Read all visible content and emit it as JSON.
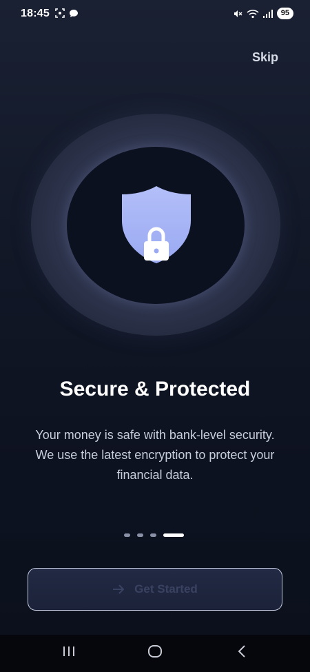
{
  "status_bar": {
    "time": "18:45",
    "battery": "95",
    "left_icons": [
      "screenshot-icon",
      "chat-bubble-icon"
    ],
    "right_icons": [
      "mute-icon",
      "wifi-icon",
      "signal-icon"
    ]
  },
  "header": {
    "skip_label": "Skip"
  },
  "hero": {
    "icon": "shield-lock-icon",
    "colors": {
      "shield": "#a6b4f7",
      "lock": "#ffffff",
      "ring": "#2f364f"
    }
  },
  "content": {
    "title": "Secure & Protected",
    "description": "Your money is safe with bank-level security. We use the latest encryption to protect your financial data."
  },
  "pager": {
    "total": 4,
    "active_index": 3
  },
  "cta": {
    "label": "Get Started",
    "icon": "arrow-right-icon"
  },
  "nav_bar": {
    "buttons": [
      "recents-icon",
      "home-icon",
      "back-icon"
    ]
  }
}
